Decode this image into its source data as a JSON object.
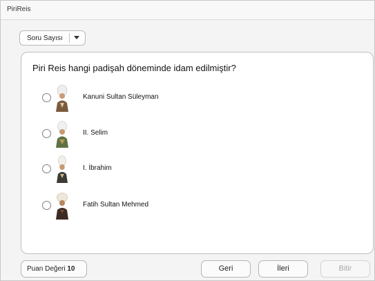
{
  "window": {
    "title": "PiriReis"
  },
  "toolbar": {
    "question_count_label": "Soru Sayısı"
  },
  "quiz": {
    "question": "Piri Reis hangi padişah döneminde idam edilmiştir?",
    "options": [
      {
        "label": "Kanuni Sultan Süleyman"
      },
      {
        "label": "II. Selim"
      },
      {
        "label": "I. İbrahim"
      },
      {
        "label": "Fatih Sultan Mehmed"
      }
    ]
  },
  "footer": {
    "score_label": "Puan Değeri",
    "score_value": "10",
    "back_label": "Geri",
    "next_label": "İleri",
    "finish_label": "Bitir"
  },
  "icons": [
    "chevron-down-icon",
    "radio-button",
    "sultan-portrait"
  ]
}
